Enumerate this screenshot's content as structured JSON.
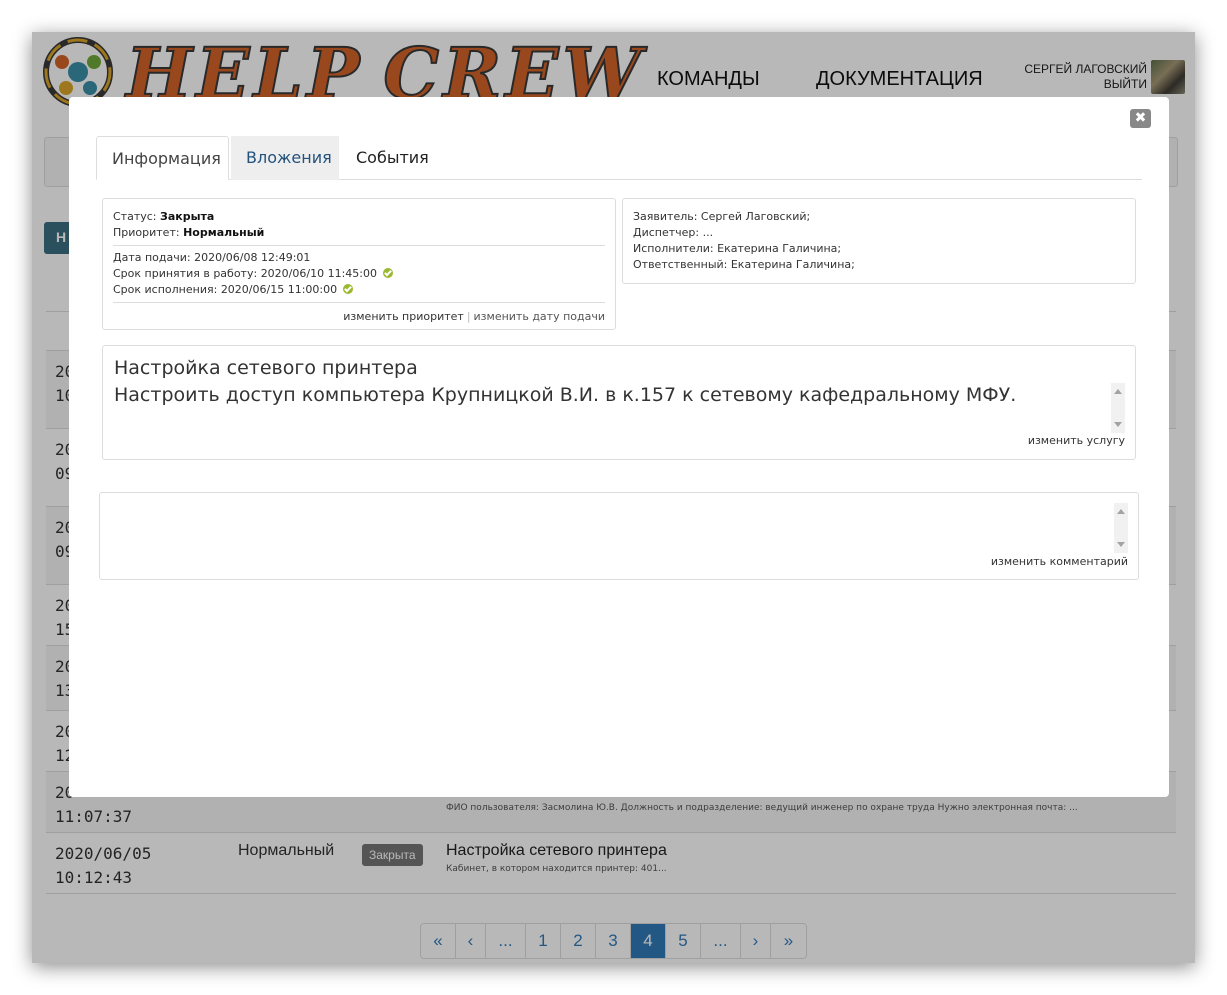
{
  "app": {
    "logo_text_1": "HELP",
    "logo_text_2": "CREW",
    "nav": [
      "КОМАНДЫ",
      "ДОКУМЕНТАЦИЯ"
    ],
    "user_name": "СЕРГЕЙ ЛАГОВСКИЙ",
    "logout": "ВЫЙТИ",
    "new_button": "Н"
  },
  "table": {
    "rows": [
      {
        "date": "20\n10",
        "alt": true
      },
      {
        "date": "20\n09",
        "alt": false
      },
      {
        "date": "20\n09",
        "alt": true
      },
      {
        "date": "20\n15",
        "alt": false
      },
      {
        "date": "20\n13",
        "alt": true
      },
      {
        "date": "20\n12",
        "alt": false
      },
      {
        "date": "20\n11:07:37",
        "alt": true,
        "desc": "ФИО пользователя: Засмолина Ю.В. Должность и подразделение: ведущий инженер по охране труда Нужно электронная почта: ..."
      },
      {
        "date": "2020/06/05\n10:12:43",
        "alt": false,
        "priority": "Нормальный",
        "status": "Закрыта",
        "title": "Настройка сетевого принтера",
        "desc": "Кабинет, в котором находится принтер: 401..."
      }
    ]
  },
  "pagination": {
    "items": [
      "«",
      "‹",
      "...",
      "1",
      "2",
      "3",
      "4",
      "5",
      "...",
      "›",
      "»"
    ],
    "active": "4"
  },
  "modal": {
    "close_icon": "✖",
    "tabs": [
      "Информация",
      "Вложения",
      "События"
    ],
    "active_tab": "Информация",
    "status_label": "Статус:",
    "status_value": "Закрыта",
    "priority_label": "Приоритет:",
    "priority_value": "Нормальный",
    "submitted_label": "Дата подачи:",
    "submitted_value": "2020/06/08 12:49:01",
    "accept_label": "Срок принятия в работу:",
    "accept_value": "2020/06/10 11:45:00",
    "due_label": "Срок исполнения:",
    "due_value": "2020/06/15 11:00:00",
    "change_priority": "изменить приоритет",
    "change_date": "изменить дату подачи",
    "people": {
      "applicant": "Заявитель: Сергей Лаговский;",
      "dispatcher": "Диспетчер: ...",
      "executors": "Исполнители: Екатерина Галичина;",
      "responsible": "Ответственный: Екатерина Галичина;"
    },
    "service_title": "Настройка сетевого принтера",
    "service_text": "Настроить доступ компьютера Крупницкой В.И. в к.157 к сетевому кафедральному МФУ.",
    "change_service": "изменить услугу",
    "comment_value": "",
    "change_comment": "изменить комментарий"
  }
}
